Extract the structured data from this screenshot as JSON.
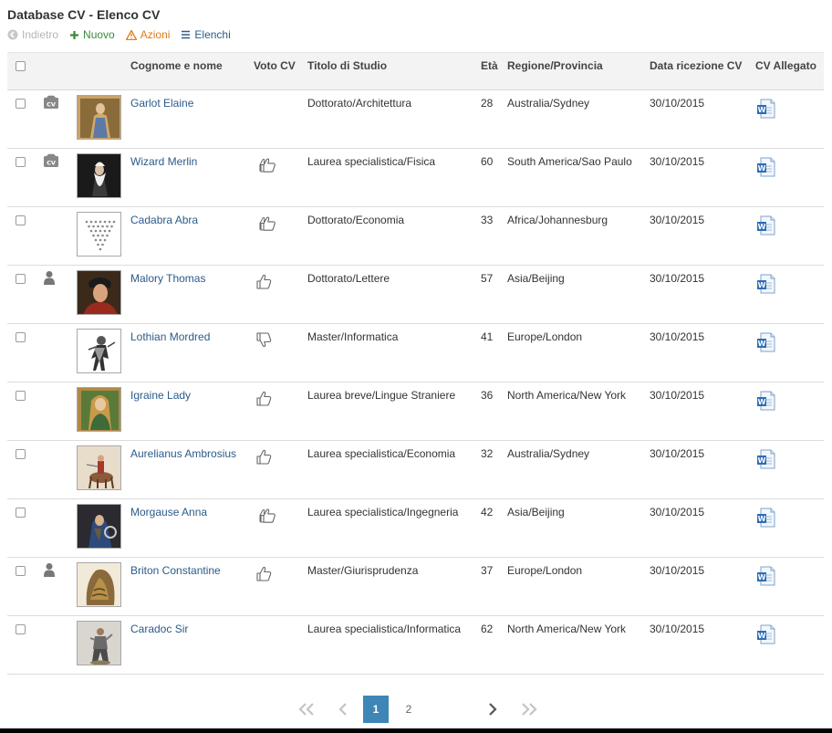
{
  "page_title": "Database CV - Elenco CV",
  "toolbar": {
    "back_label": "Indietro",
    "new_label": "Nuovo",
    "actions_label": "Azioni",
    "lists_label": "Elenchi"
  },
  "columns": {
    "name": "Cognome e nome",
    "vote": "Voto CV",
    "degree": "Titolo di Studio",
    "age": "Età",
    "region": "Regione/Provincia",
    "date": "Data ricezione CV",
    "attachment": "CV Allegato"
  },
  "rows": [
    {
      "name": "Garlot Elaine",
      "status_icon": "cv-icon",
      "vote": "",
      "degree": "Dottorato/Architettura",
      "age": "28",
      "region": "Australia/Sydney",
      "date": "30/10/2015"
    },
    {
      "name": "Wizard Merlin",
      "status_icon": "cv-icon",
      "vote": "double-thumbs-up-icon",
      "degree": "Laurea specialistica/Fisica",
      "age": "60",
      "region": "South America/Sao Paulo",
      "date": "30/10/2015"
    },
    {
      "name": "Cadabra Abra",
      "status_icon": "",
      "vote": "double-thumbs-up-icon",
      "degree": "Dottorato/Economia",
      "age": "33",
      "region": "Africa/Johannesburg",
      "date": "30/10/2015"
    },
    {
      "name": "Malory Thomas",
      "status_icon": "person-icon",
      "vote": "thumbs-up-icon",
      "degree": "Dottorato/Lettere",
      "age": "57",
      "region": "Asia/Beijing",
      "date": "30/10/2015"
    },
    {
      "name": "Lothian Mordred",
      "status_icon": "",
      "vote": "thumbs-down-icon",
      "degree": "Master/Informatica",
      "age": "41",
      "region": "Europe/London",
      "date": "30/10/2015"
    },
    {
      "name": "Igraine Lady",
      "status_icon": "",
      "vote": "thumbs-up-icon",
      "degree": "Laurea breve/Lingue Straniere",
      "age": "36",
      "region": "North America/New York",
      "date": "30/10/2015"
    },
    {
      "name": "Aurelianus Ambrosius",
      "status_icon": "",
      "vote": "thumbs-up-icon",
      "degree": "Laurea specialistica/Economia",
      "age": "32",
      "region": "Australia/Sydney",
      "date": "30/10/2015"
    },
    {
      "name": "Morgause Anna",
      "status_icon": "",
      "vote": "double-thumbs-up-icon",
      "degree": "Laurea specialistica/Ingegneria",
      "age": "42",
      "region": "Asia/Beijing",
      "date": "30/10/2015"
    },
    {
      "name": "Briton Constantine",
      "status_icon": "person-icon",
      "vote": "thumbs-up-icon",
      "degree": "Master/Giurisprudenza",
      "age": "37",
      "region": "Europe/London",
      "date": "30/10/2015"
    },
    {
      "name": "Caradoc Sir",
      "status_icon": "",
      "vote": "",
      "degree": "Laurea specialistica/Informatica",
      "age": "62",
      "region": "North America/New York",
      "date": "30/10/2015"
    }
  ],
  "pagination": {
    "pages": [
      "1",
      "2"
    ],
    "current": "1"
  },
  "colors": {
    "link": "#2b5b8a",
    "new": "#3a8a3a",
    "actions": "#e07b1a",
    "active_page": "#3e86b5"
  }
}
